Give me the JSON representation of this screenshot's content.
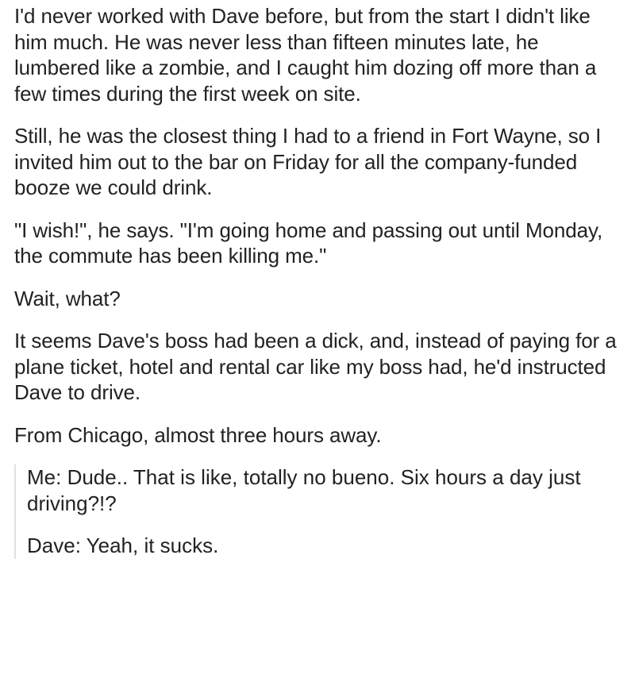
{
  "post": {
    "paragraphs": [
      "I'd never worked with Dave before, but from the start I didn't like him much. He was never less than fifteen minutes late, he lumbered like a zombie, and I caught him dozing off more than a few times during the first week on site.",
      "Still, he was the closest thing I had to a friend in Fort Wayne, so I invited him out to the bar on Friday for all the company-funded booze we could drink.",
      "\"I wish!\", he says. \"I'm going home and passing out until Monday, the commute has been killing me.\"",
      "Wait, what?",
      "It seems Dave's boss had been a dick, and, instead of paying for a plane ticket, hotel and rental car like my boss had, he'd instructed Dave to drive.",
      "From Chicago, almost three hours away."
    ],
    "quote": {
      "me_line": "Me: Dude.. That is like, totally no bueno. Six hours a day just driving?!?",
      "dave_line": "Dave: Yeah, it sucks."
    }
  }
}
